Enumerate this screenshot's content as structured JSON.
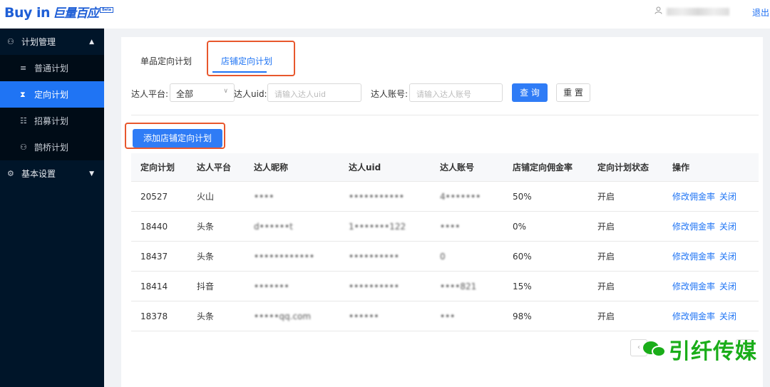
{
  "header": {
    "logo_en": "Buy in",
    "logo_cn": "巨量百应",
    "logo_badge": "Beta",
    "user_name": "•••••••",
    "logout": "退出"
  },
  "sidebar": {
    "groups": [
      {
        "label": "计划管理",
        "icon": "plan-icon",
        "expanded": true,
        "items": [
          {
            "label": "普通计划",
            "icon": "list-icon",
            "active": false
          },
          {
            "label": "定向计划",
            "icon": "hourglass-icon",
            "active": true
          },
          {
            "label": "招募计划",
            "icon": "recruit-icon",
            "active": false
          },
          {
            "label": "鹊桥计划",
            "icon": "bridge-icon",
            "active": false
          }
        ]
      },
      {
        "label": "基本设置",
        "icon": "gear-icon",
        "expanded": false
      }
    ]
  },
  "tabs": [
    {
      "label": "单品定向计划",
      "active": false
    },
    {
      "label": "店铺定向计划",
      "active": true
    }
  ],
  "filters": {
    "platform_label": "达人平台:",
    "platform_value": "全部",
    "uid_label": "达人uid:",
    "uid_placeholder": "请输入达人uid",
    "account_label": "达人账号:",
    "account_placeholder": "请输入达人账号",
    "search_button": "查 询",
    "reset_button": "重 置"
  },
  "add_button": "添加店铺定向计划",
  "table": {
    "columns": [
      "定向计划",
      "达人平台",
      "达人昵称",
      "达人uid",
      "达人账号",
      "店铺定向佣金率",
      "定向计划状态",
      "操作"
    ],
    "rows": [
      {
        "plan": "20527",
        "platform": "火山",
        "nickname": "••••",
        "uid": "•••••••••••",
        "account": "4•••••••",
        "rate": "50%",
        "status": "开启",
        "action1": "修改佣金率",
        "action2": "关闭"
      },
      {
        "plan": "18440",
        "platform": "头条",
        "nickname": "d••••••t",
        "uid": "1•••••••122",
        "account": "••••",
        "rate": "0%",
        "status": "开启",
        "action1": "修改佣金率",
        "action2": "关闭"
      },
      {
        "plan": "18437",
        "platform": "头条",
        "nickname": "••••••••••••",
        "uid": "••••••••••",
        "account": "0",
        "rate": "60%",
        "status": "开启",
        "action1": "修改佣金率",
        "action2": "关闭"
      },
      {
        "plan": "18414",
        "platform": "抖音",
        "nickname": "•••••••",
        "uid": "••••••••••",
        "account": "••••821",
        "rate": "15%",
        "status": "开启",
        "action1": "修改佣金率",
        "action2": "关闭"
      },
      {
        "plan": "18378",
        "platform": "头条",
        "nickname": "•••••qq.com",
        "uid": "••••••",
        "account": "•••",
        "rate": "98%",
        "status": "开启",
        "action1": "修改佣金率",
        "action2": "关闭"
      }
    ]
  },
  "watermark": "引纤传媒",
  "colors": {
    "accent": "#1f74f4",
    "sidebar_bg": "#001529",
    "highlight_box": "#e8572d",
    "watermark": "#1aad19"
  }
}
